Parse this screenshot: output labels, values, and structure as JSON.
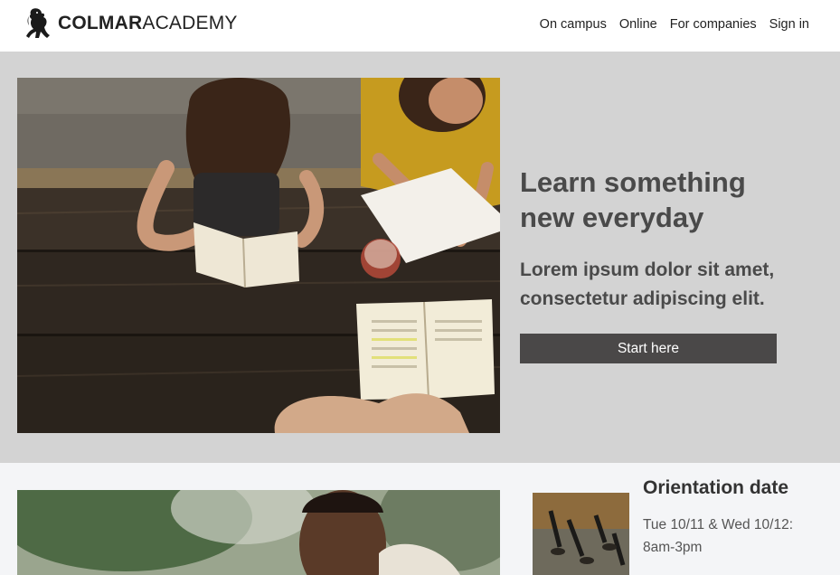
{
  "brand": {
    "bold": "COLMAR",
    "light": "ACADEMY"
  },
  "nav": [
    {
      "label": "On campus"
    },
    {
      "label": "Online"
    },
    {
      "label": "For companies"
    },
    {
      "label": "Sign in"
    }
  ],
  "hero": {
    "title": "Learn something new everyday",
    "subtitle": "Lorem ipsum dolor sit amet, consectetur adipiscing elit.",
    "cta_label": "Start here"
  },
  "orientation": {
    "title": "Orientation date",
    "date": "Tue 10/11 & Wed 10/12: 8am-3pm"
  },
  "colors": {
    "hero_bg": "#d3d3d3",
    "cta_bg": "#4a4848",
    "section_bg": "#f4f5f7"
  }
}
